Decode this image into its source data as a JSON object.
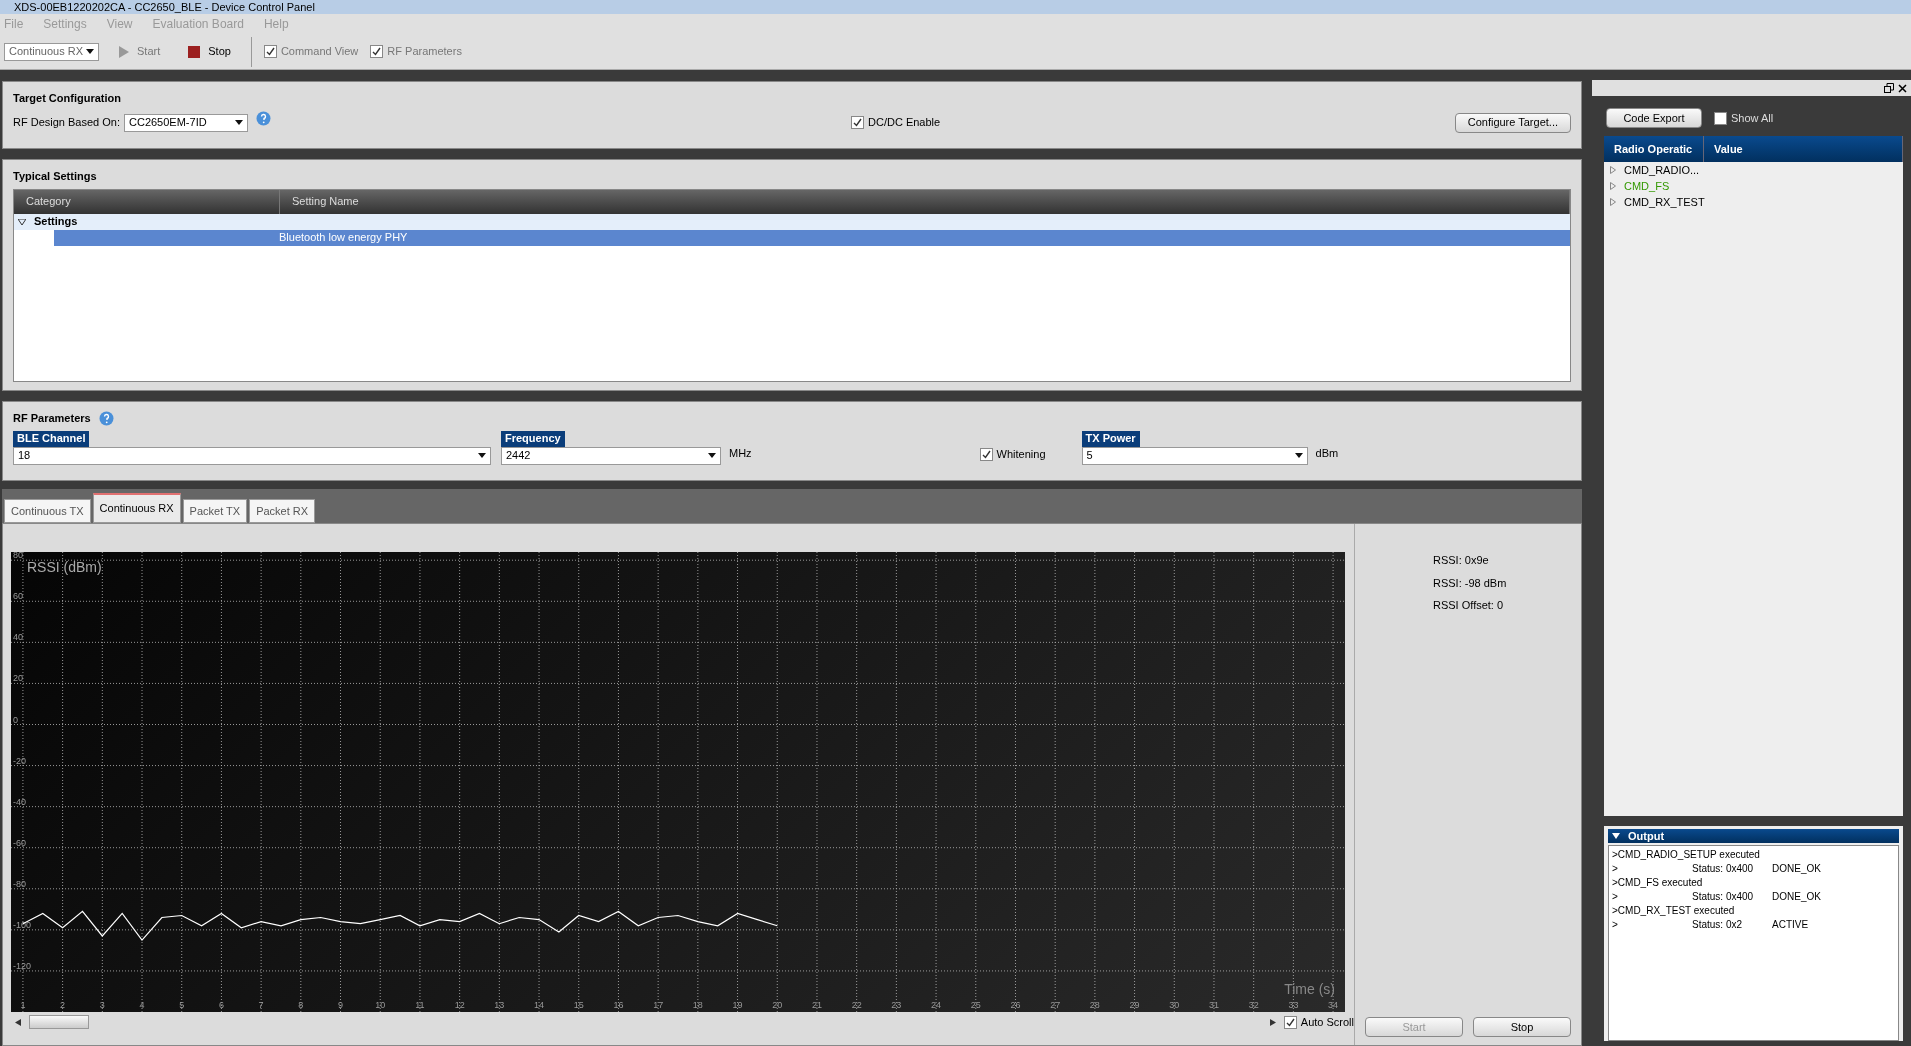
{
  "window": {
    "title": "XDS-00EB1220202CA - CC2650_BLE - Device Control Panel"
  },
  "menu": [
    "File",
    "Settings",
    "View",
    "Evaluation Board",
    "Help"
  ],
  "toolbar": {
    "mode": "Continuous RX",
    "start": {
      "label": "Start",
      "disabled": true
    },
    "stop": {
      "label": "Stop",
      "disabled": false
    },
    "toggles": [
      {
        "label": "Command View",
        "checked": true
      },
      {
        "label": "RF Parameters",
        "checked": true
      }
    ]
  },
  "target_configuration": {
    "title": "Target Configuration",
    "rf_design_label": "RF Design Based On:",
    "rf_design": "CC2650EM-7ID",
    "dcdc": {
      "label": "DC/DC Enable",
      "checked": true
    },
    "configure_button": "Configure Target..."
  },
  "typical_settings": {
    "title": "Typical Settings",
    "columns": [
      "Category",
      "Setting Name"
    ],
    "tree": [
      {
        "label": "Settings",
        "expanded": true,
        "children": [
          {
            "label": "Bluetooth low energy PHY",
            "selected": true
          }
        ]
      }
    ]
  },
  "rf_parameters": {
    "title": "RF Parameters",
    "ble_channel": {
      "label": "BLE Channel",
      "value": "18"
    },
    "frequency": {
      "label": "Frequency",
      "value": "2442",
      "unit": "MHz"
    },
    "whitening": {
      "label": "Whitening",
      "checked": true
    },
    "tx_power": {
      "label": "TX Power",
      "value": "5",
      "unit": "dBm"
    }
  },
  "tabs": [
    {
      "label": "Continuous TX",
      "selected": false
    },
    {
      "label": "Continuous RX",
      "selected": true
    },
    {
      "label": "Packet TX",
      "selected": false
    },
    {
      "label": "Packet RX",
      "selected": false
    }
  ],
  "rx_panel": {
    "chart_data": {
      "type": "line",
      "ylabel": "RSSI (dBm)",
      "xlabel": "Time (s)",
      "grid": true,
      "xlim": [
        0.7,
        34.3
      ],
      "ylim": [
        -140,
        84
      ],
      "yticks": [
        80,
        60,
        40,
        20,
        0,
        -20,
        -40,
        -60,
        -80,
        -100,
        -120
      ],
      "xticks": [
        1,
        2,
        3,
        4,
        5,
        6,
        7,
        8,
        9,
        10,
        11,
        12,
        13,
        14,
        15,
        16,
        17,
        18,
        19,
        20,
        21,
        22,
        23,
        24,
        25,
        26,
        27,
        28,
        29,
        30,
        31,
        32,
        33,
        34
      ],
      "x": [
        1,
        1.5,
        2,
        2.5,
        3,
        3.5,
        4,
        4.5,
        5,
        5.5,
        6,
        6.5,
        7,
        7.5,
        8,
        8.5,
        9,
        9.5,
        10,
        10.5,
        11,
        11.5,
        12,
        12.5,
        13,
        13.5,
        14,
        14.5,
        15,
        15.5,
        16,
        16.5,
        17,
        17.5,
        18,
        18.5,
        19,
        19.5,
        20
      ],
      "series": [
        {
          "color": "#ffffff",
          "values": [
            -97,
            -92,
            -99,
            -91,
            -103,
            -92,
            -105,
            -94,
            -93,
            -98,
            -92,
            -99,
            -96,
            -98,
            -95,
            -94,
            -96,
            -97,
            -95,
            -93,
            -98,
            -95,
            -96,
            -92,
            -97,
            -94,
            -95,
            -101,
            -93,
            -96,
            -91,
            -98,
            -94,
            -93,
            -96,
            -98,
            -92,
            -95,
            -98
          ]
        }
      ]
    },
    "auto_scroll": {
      "label": "Auto Scroll",
      "checked": true
    },
    "readings": [
      "RSSI: 0x9e",
      "RSSI: -98 dBm",
      "RSSI Offset: 0"
    ],
    "start": {
      "label": "Start",
      "disabled": true
    },
    "stop": {
      "label": "Stop",
      "disabled": false
    }
  },
  "command_panel": {
    "code_export": "Code Export",
    "show_all": {
      "label": "Show All",
      "checked": false
    },
    "columns": [
      "Radio Operatic",
      "Value"
    ],
    "operations": [
      {
        "label": "CMD_RADIO...",
        "color": "#000000",
        "expanded": false
      },
      {
        "label": "CMD_FS",
        "color": "#339900",
        "expanded": false
      },
      {
        "label": "CMD_RX_TEST",
        "color": "#000000",
        "expanded": false
      }
    ]
  },
  "output": {
    "title": "Output",
    "expanded": true,
    "lines": [
      {
        "kind": "command",
        "text": ">CMD_RADIO_SETUP executed"
      },
      {
        "kind": "status",
        "prefix": ">",
        "status": "Status: 0x400",
        "result": "DONE_OK"
      },
      {
        "kind": "command",
        "text": ">CMD_FS executed"
      },
      {
        "kind": "status",
        "prefix": ">",
        "status": "Status: 0x400",
        "result": "DONE_OK"
      },
      {
        "kind": "command",
        "text": ">CMD_RX_TEST executed"
      },
      {
        "kind": "status",
        "prefix": ">",
        "status": "Status: 0x2",
        "result": "ACTIVE"
      }
    ]
  }
}
